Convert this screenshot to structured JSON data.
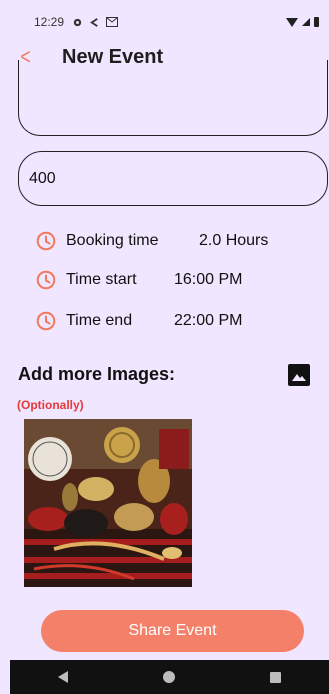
{
  "status_bar": {
    "time": "12:29"
  },
  "header": {
    "title": "New Event"
  },
  "form": {
    "price_value": "400",
    "booking_time": {
      "label": "Booking time",
      "value": "2.0 Hours"
    },
    "time_start": {
      "label": "Time start",
      "value": "16:00 PM"
    },
    "time_end": {
      "label": "Time end",
      "value": "22:00 PM"
    }
  },
  "images": {
    "title": "Add more Images:",
    "optional": "(Optionally)"
  },
  "actions": {
    "share_label": "Share Event"
  },
  "colors": {
    "accent": "#f4806a",
    "background": "#f1e6ff",
    "optional_red": "#e53a3a"
  }
}
